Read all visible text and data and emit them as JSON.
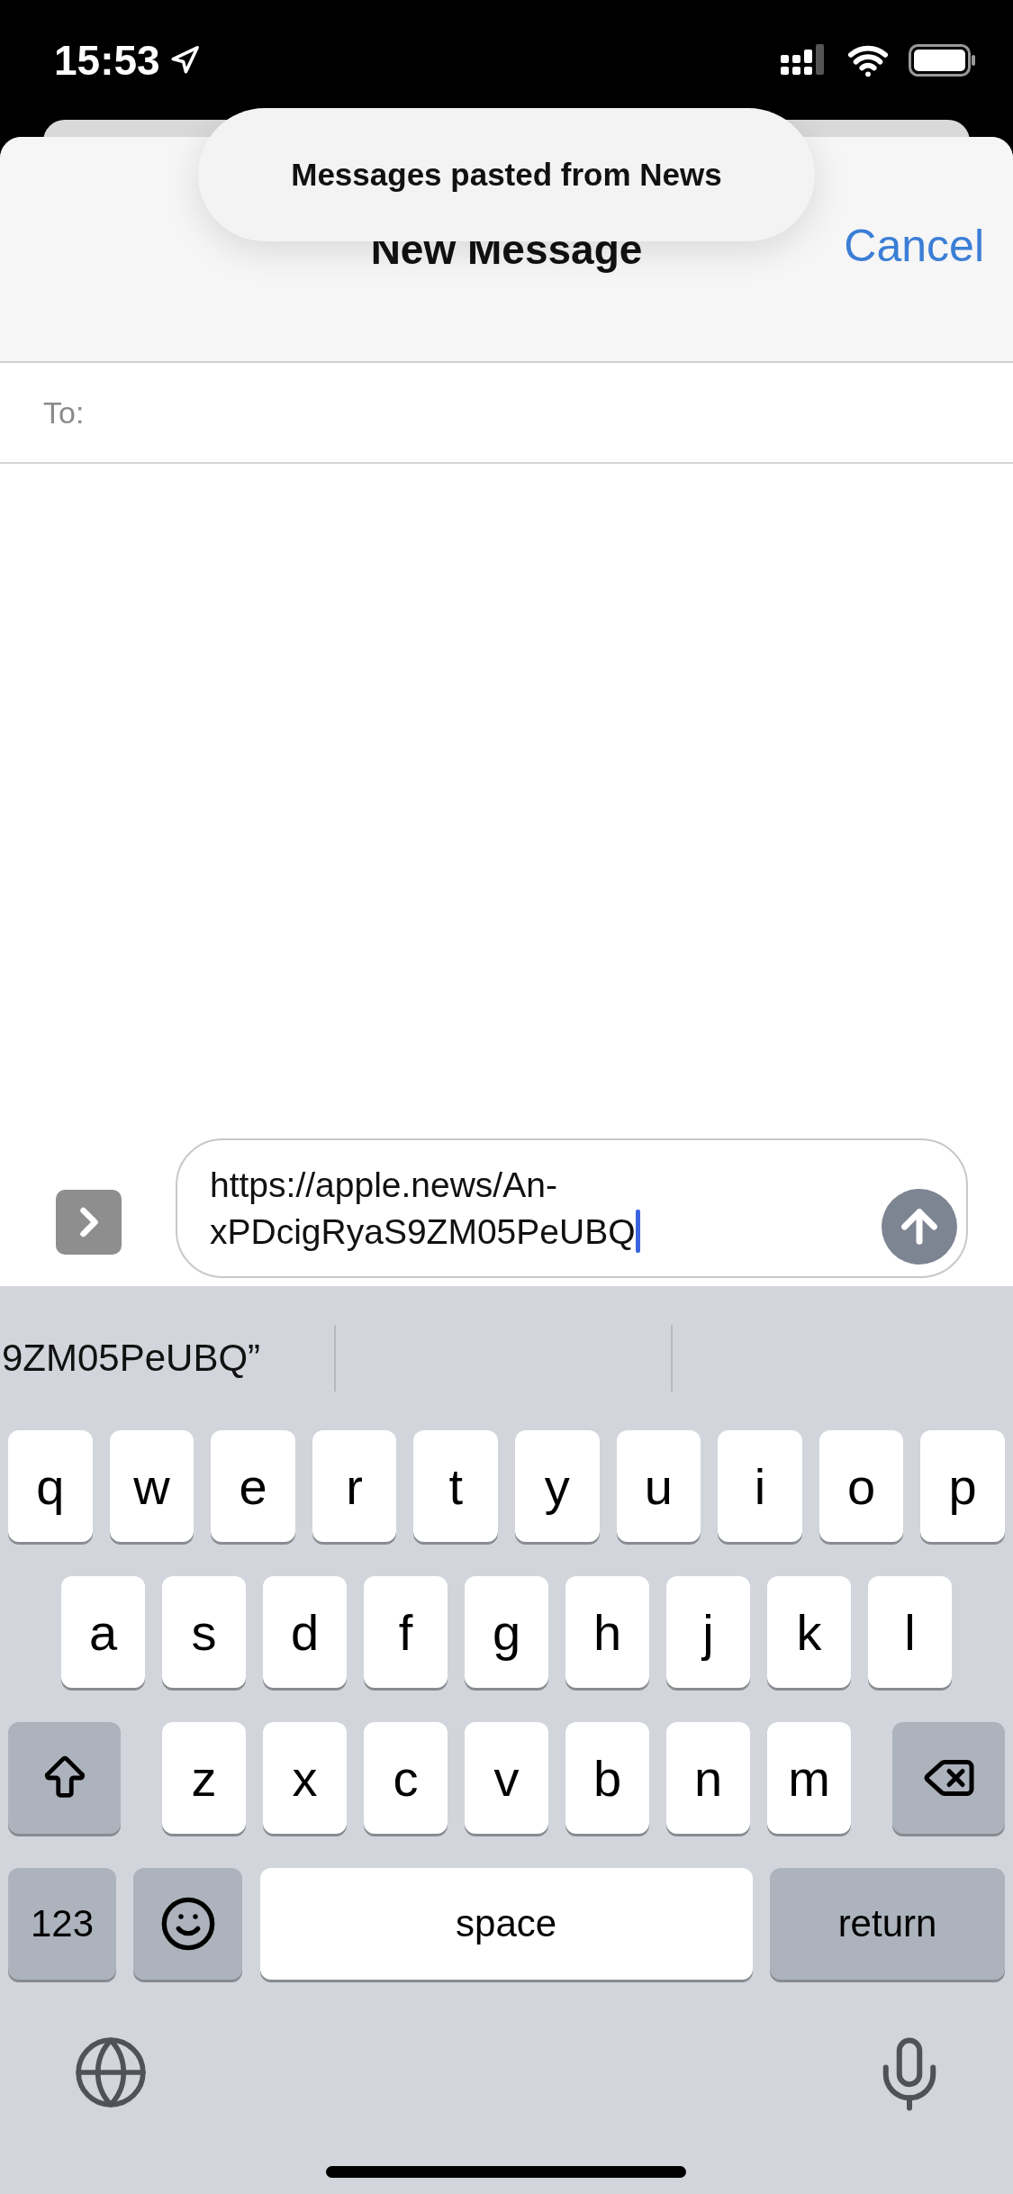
{
  "status_bar": {
    "time": "15:53"
  },
  "toast": {
    "text": "Messages pasted from News"
  },
  "header": {
    "title": "New Message",
    "cancel": "Cancel"
  },
  "to_field": {
    "label": "To:"
  },
  "composer": {
    "value": "https://apple.news/An-xPDcigRyaS9ZM05PeUBQ"
  },
  "suggestions": [
    "9ZM05PeUBQ”"
  ],
  "keyboard": {
    "rows": [
      [
        "q",
        "w",
        "e",
        "r",
        "t",
        "y",
        "u",
        "i",
        "o",
        "p"
      ],
      [
        "a",
        "s",
        "d",
        "f",
        "g",
        "h",
        "j",
        "k",
        "l"
      ],
      [
        "z",
        "x",
        "c",
        "v",
        "b",
        "n",
        "m"
      ]
    ],
    "numbers_key": "123",
    "space_key": "space",
    "return_key": "return"
  }
}
